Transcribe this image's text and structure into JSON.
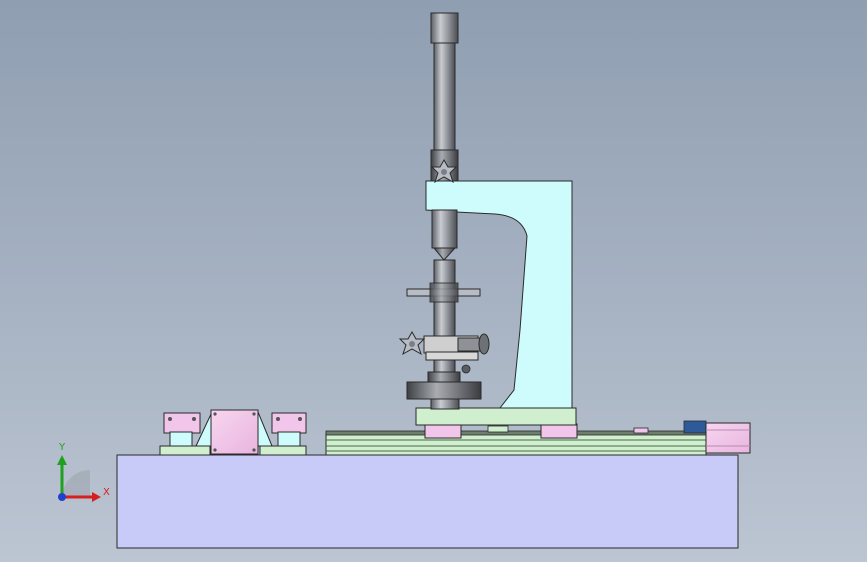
{
  "viewport": {
    "background_top": "#8f9eb1",
    "background_bottom": "#bcc5d2"
  },
  "triad": {
    "x_label": "X",
    "y_label": "Y",
    "x_color": "#d42020",
    "y_color": "#20a020",
    "z_color": "#2040d0"
  },
  "colors": {
    "base_block": "#c8caf7",
    "frame_cyan": "#cefcfc",
    "column_gray": "#8a8d92",
    "rail_green": "#cfefcf",
    "block_pink": "#f2c6ea",
    "knob_gray": "#b8bcc4",
    "edge": "#2a2a2a"
  }
}
